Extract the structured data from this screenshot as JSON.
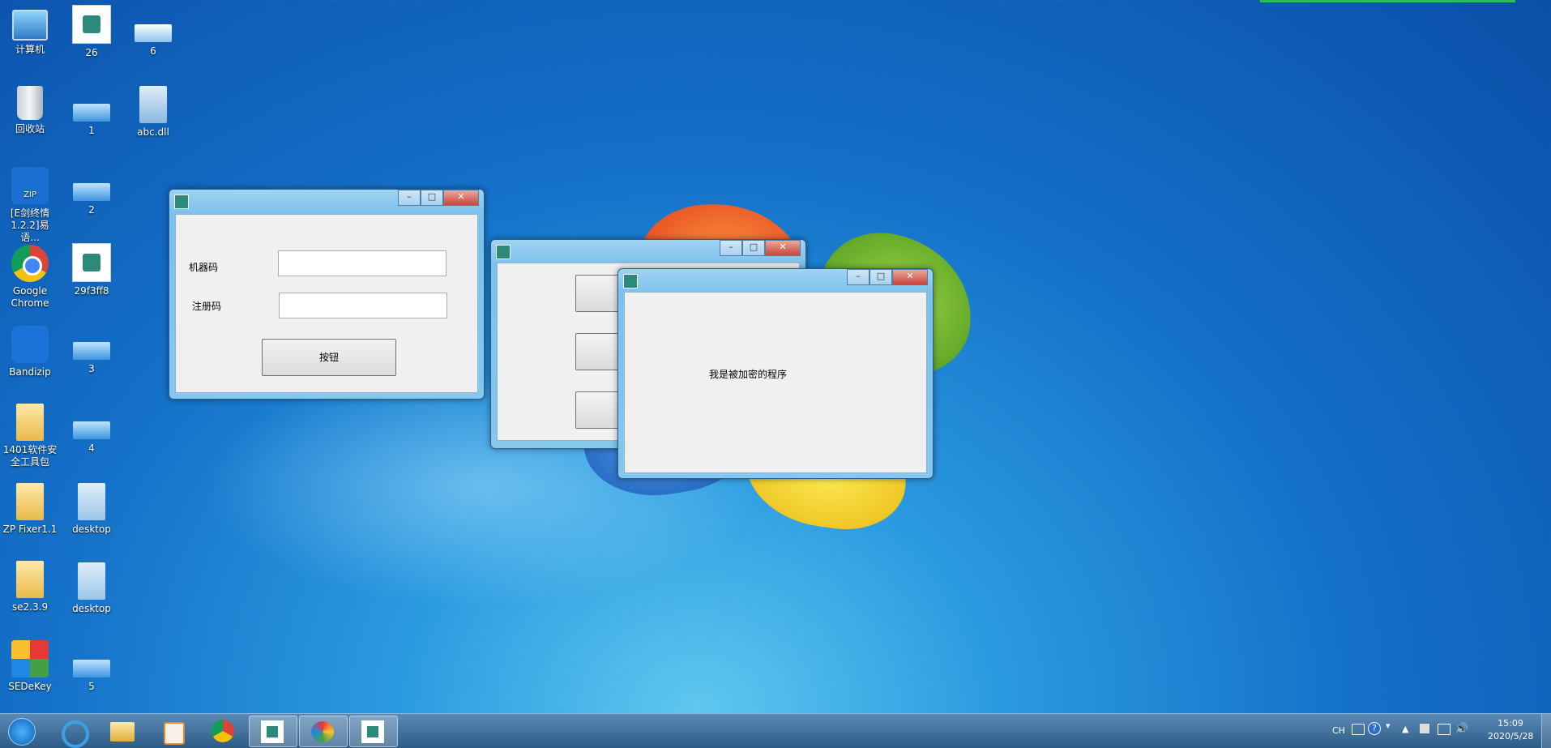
{
  "desktop": {
    "icons": [
      {
        "label": "计算机",
        "icon": "computer-icon"
      },
      {
        "label": "26",
        "icon": "yiyu-app-icon"
      },
      {
        "label": "6",
        "icon": "window-file-icon"
      },
      {
        "label": "回收站",
        "icon": "recycle-bin-icon"
      },
      {
        "label": "1",
        "icon": "window-file-icon"
      },
      {
        "label": "abc.dll",
        "icon": "dll-file-icon"
      },
      {
        "label": "[E剑终情1.2.2]易语...",
        "icon": "zip-icon"
      },
      {
        "label": "2",
        "icon": "window-file-icon"
      },
      {
        "label": "Google Chrome",
        "icon": "chrome-icon"
      },
      {
        "label": "29f3ff8",
        "icon": "yiyu-app-icon"
      },
      {
        "label": "Bandizip",
        "icon": "bandizip-icon"
      },
      {
        "label": "3",
        "icon": "window-file-icon"
      },
      {
        "label": "1401软件安全工具包",
        "icon": "folder-icon"
      },
      {
        "label": "4",
        "icon": "window-file-icon"
      },
      {
        "label": "ZP Fixer1.1",
        "icon": "folder-icon"
      },
      {
        "label": "desktop",
        "icon": "config-file-icon"
      },
      {
        "label": "se2.3.9",
        "icon": "folder-icon"
      },
      {
        "label": "desktop",
        "icon": "config-file-icon"
      },
      {
        "label": "SEDeKey",
        "icon": "sedekey-icon"
      },
      {
        "label": "5",
        "icon": "window-file-icon"
      }
    ]
  },
  "window1": {
    "label_machine_code": "机器码",
    "label_reg_code": "注册码",
    "machine_code_value": "",
    "reg_code_value": "",
    "button_label": "按钮"
  },
  "window3": {
    "message": "我是被加密的程序"
  },
  "taskbar": {
    "items": [
      "start-orb-icon",
      "ie-icon",
      "explorer-icon",
      "media-player-icon",
      "chrome-icon",
      "yiyu-app-icon",
      "paint-icon",
      "yiyu-app-icon"
    ],
    "tray": {
      "lang": "CH",
      "time": "15:09",
      "date": "2020/5/28"
    }
  },
  "colors": {
    "accent": "#1470c8",
    "taskbar": "#2c5b86"
  }
}
